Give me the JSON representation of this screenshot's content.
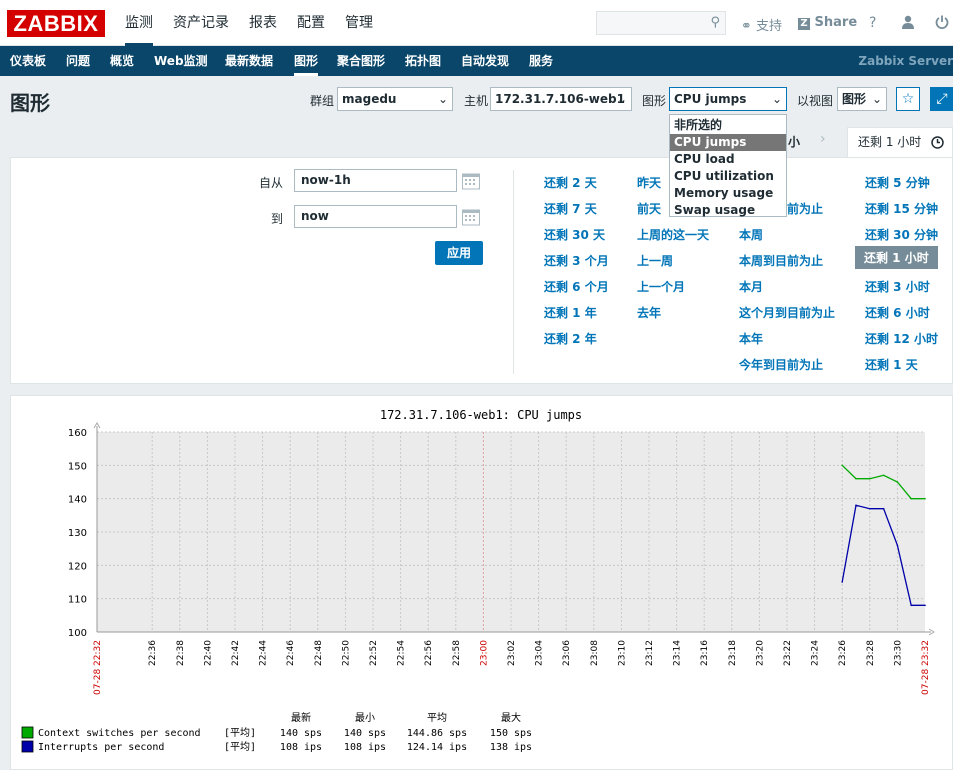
{
  "brand": {
    "logo": "ZABBIX"
  },
  "top_menu": [
    {
      "label": "监测",
      "active": true
    },
    {
      "label": "资产记录",
      "active": false
    },
    {
      "label": "报表",
      "active": false
    },
    {
      "label": "配置",
      "active": false
    },
    {
      "label": "管理",
      "active": false
    }
  ],
  "top_right": {
    "support": "支持",
    "share": "Share",
    "help": "?",
    "user": "user-icon",
    "power": "power-icon"
  },
  "sub_menu": [
    "仪表板",
    "问题",
    "概览",
    "Web监测",
    "最新数据",
    "图形",
    "聚合图形",
    "拓扑图",
    "自动发现",
    "服务"
  ],
  "sub_menu_active": "图形",
  "server_name": "Zabbix Server",
  "page": {
    "title": "图形",
    "group_label": "群组",
    "group_value": "magedu",
    "host_label": "主机",
    "host_value": "172.31.7.106-web1",
    "graph_label": "图形",
    "graph_value": "CPU jumps",
    "view_label": "以视图",
    "view_value": "图形"
  },
  "graph_dropdown": {
    "options": [
      "非所选的",
      "CPU jumps",
      "CPU load",
      "CPU utilization",
      "Memory usage",
      "Swap usage"
    ],
    "selected": "CPU jumps"
  },
  "time_tabs": {
    "prev_partial": "小",
    "active": "还剩 1 小时"
  },
  "filter": {
    "from_label": "自从",
    "from_value": "now-1h",
    "to_label": "到",
    "to_value": "now",
    "apply": "应用"
  },
  "quick_ranges": {
    "col1": [
      "还剩 2 天",
      "还剩 7 天",
      "还剩 30 天",
      "还剩 3 个月",
      "还剩 6 个月",
      "还剩 1 年",
      "还剩 2 年"
    ],
    "col2": [
      "昨天",
      "前天",
      "上周的这一天",
      "上一周",
      "上一个月",
      "去年"
    ],
    "col3": [
      "前为止",
      "本周",
      "本周到目前为止",
      "本月",
      "这个月到目前为止",
      "本年",
      "今年到目前为止"
    ],
    "col4": [
      "还剩 5 分钟",
      "还剩 15 分钟",
      "还剩 30 分钟",
      "还剩 1 小时",
      "还剩 3 小时",
      "还剩 6 小时",
      "还剩 12 小时",
      "还剩 1 天"
    ],
    "active": "还剩 1 小时"
  },
  "chart_data": {
    "type": "line",
    "title": "172.31.7.106-web1: CPU jumps",
    "ylim": [
      100,
      160
    ],
    "yticks": [
      100,
      110,
      120,
      130,
      140,
      150,
      160
    ],
    "x_start_label": "07-28 22:32",
    "x_end_label": "07-28 23:32",
    "x_ticks": [
      "22:36",
      "22:38",
      "22:40",
      "22:42",
      "22:44",
      "22:46",
      "22:48",
      "22:50",
      "22:52",
      "22:54",
      "22:56",
      "22:58",
      "23:00",
      "23:02",
      "23:04",
      "23:06",
      "23:08",
      "23:10",
      "23:12",
      "23:14",
      "23:16",
      "23:18",
      "23:20",
      "23:22",
      "23:24",
      "23:26",
      "23:28",
      "23:30"
    ],
    "x_highlight": "23:00",
    "grid": true,
    "x_unit": "minutes",
    "series": [
      {
        "name": "Context switches per second",
        "color": "#00aa00",
        "points": [
          [
            "23:26",
            150
          ],
          [
            "23:27",
            146
          ],
          [
            "23:28",
            146
          ],
          [
            "23:29",
            147
          ],
          [
            "23:30",
            145
          ],
          [
            "23:31",
            140
          ],
          [
            "23:32",
            140
          ]
        ]
      },
      {
        "name": "Interrupts per second",
        "color": "#0000aa",
        "points": [
          [
            "23:26",
            115
          ],
          [
            "23:27",
            138
          ],
          [
            "23:28",
            137
          ],
          [
            "23:29",
            137
          ],
          [
            "23:30",
            126
          ],
          [
            "23:31",
            108
          ],
          [
            "23:32",
            108
          ]
        ]
      }
    ],
    "legend_header": {
      "last": "最新",
      "min": "最小",
      "avg": "平均",
      "max": "最大"
    },
    "legend_rows": [
      {
        "name": "Context switches per second",
        "func": "[平均]",
        "last": "140 sps",
        "min": "140 sps",
        "avg": "144.86 sps",
        "max": "150 sps",
        "color": "#00aa00"
      },
      {
        "name": "Interrupts per second",
        "func": "[平均]",
        "last": "108 ips",
        "min": "108 ips",
        "avg": "124.14 ips",
        "max": "138 ips",
        "color": "#0000aa"
      }
    ]
  }
}
